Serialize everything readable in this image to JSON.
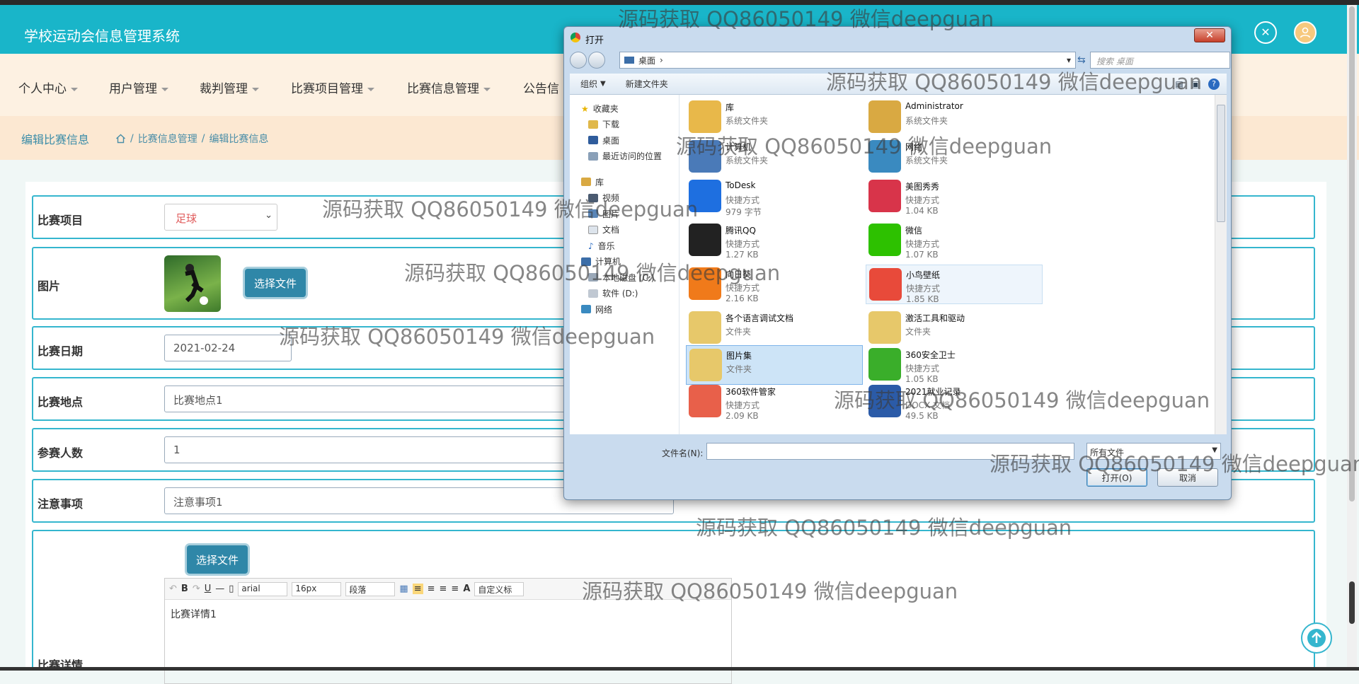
{
  "app": {
    "title": "学校运动会信息管理系统"
  },
  "nav": {
    "items": [
      "个人中心",
      "用户管理",
      "裁判管理",
      "比赛项目管理",
      "比赛信息管理",
      "公告信"
    ]
  },
  "breadcrumb": {
    "title": "编辑比赛信息",
    "items": [
      "比赛信息管理",
      "编辑比赛信息"
    ],
    "separator": "/"
  },
  "form": {
    "project": {
      "label": "比赛项目",
      "value": "足球"
    },
    "image": {
      "label": "图片",
      "button": "选择文件"
    },
    "date": {
      "label": "比赛日期",
      "value": "2021-02-24"
    },
    "location": {
      "label": "比赛地点",
      "value": "比赛地点1"
    },
    "participants": {
      "label": "参赛人数",
      "value": "1"
    },
    "notes": {
      "label": "注意事项",
      "value": "注意事项1"
    },
    "details": {
      "label": "比赛详情",
      "button": "选择文件",
      "font": "arial",
      "size": "16px",
      "paragraph": "段落",
      "custom_label": "自定义标",
      "content": "比赛详情1"
    }
  },
  "dialog": {
    "title": "打开",
    "address": "桌面",
    "search_placeholder": "搜索 桌面",
    "toolbar": {
      "organize": "组织",
      "new_folder": "新建文件夹"
    },
    "tree": {
      "favorites": "收藏夹",
      "favorites_items": [
        "下载",
        "桌面",
        "最近访问的位置"
      ],
      "library": "库",
      "library_items": [
        "视频",
        "图片",
        "文档",
        "音乐"
      ],
      "computer": "计算机",
      "computer_items": [
        "本地磁盘 (C:)",
        "软件 (D:)"
      ],
      "network": "网络"
    },
    "files": [
      {
        "name": "库",
        "type": "系统文件夹",
        "size": "",
        "icon": "library-folder-icon",
        "color": "#e8b84a"
      },
      {
        "name": "Administrator",
        "type": "系统文件夹",
        "size": "",
        "icon": "user-folder-icon",
        "color": "#d9a942"
      },
      {
        "name": "计算机",
        "type": "系统文件夹",
        "size": "",
        "icon": "computer-icon",
        "color": "#4a7ab8"
      },
      {
        "name": "网络",
        "type": "系统文件夹",
        "size": "",
        "icon": "network-icon",
        "color": "#3a8ac0"
      },
      {
        "name": "ToDesk",
        "type": "快捷方式",
        "size": "979 字节",
        "icon": "todesk-icon",
        "color": "#1e6fe0"
      },
      {
        "name": "美图秀秀",
        "type": "快捷方式",
        "size": "1.04 KB",
        "icon": "meitu-icon",
        "color": "#d8344a"
      },
      {
        "name": "腾讯QQ",
        "type": "快捷方式",
        "size": "1.27 KB",
        "icon": "qq-icon",
        "color": "#222222"
      },
      {
        "name": "微信",
        "type": "快捷方式",
        "size": "1.07 KB",
        "icon": "wechat-icon",
        "color": "#2dc100"
      },
      {
        "name": "向日葵",
        "type": "快捷方式",
        "size": "2.16 KB",
        "icon": "sunflower-icon",
        "color": "#f07a1a"
      },
      {
        "name": "小鸟壁纸",
        "type": "快捷方式",
        "size": "1.85 KB",
        "icon": "bird-wallpaper-icon",
        "color": "#e84a3a"
      },
      {
        "name": "各个语言调试文档",
        "type": "文件夹",
        "size": "",
        "icon": "folder-icon",
        "color": "#e7c86a"
      },
      {
        "name": "激活工具和驱动",
        "type": "文件夹",
        "size": "",
        "icon": "folder-icon",
        "color": "#e7c86a"
      },
      {
        "name": "图片集",
        "type": "文件夹",
        "size": "",
        "icon": "folder-icon",
        "color": "#e7c86a"
      },
      {
        "name": "360安全卫士",
        "type": "快捷方式",
        "size": "1.05 KB",
        "icon": "360-safe-icon",
        "color": "#3aae2a"
      },
      {
        "name": "360软件管家",
        "type": "快捷方式",
        "size": "2.09 KB",
        "icon": "360-software-icon",
        "color": "#e8604a"
      },
      {
        "name": "2021就业记录",
        "type": "DOCX 文档",
        "size": "49.5 KB",
        "icon": "docx-icon",
        "color": "#2b5ba8"
      }
    ],
    "filename_label": "文件名(N):",
    "filetype": "所有文件",
    "open_button": "打开(O)",
    "cancel_button": "取消"
  },
  "watermark": "源码获取 QQ86050149 微信deepguan",
  "colors": {
    "header": "#19b5c9",
    "nav": "#fdf1e2",
    "accent": "#35b6ce",
    "button": "#2f87a8"
  }
}
